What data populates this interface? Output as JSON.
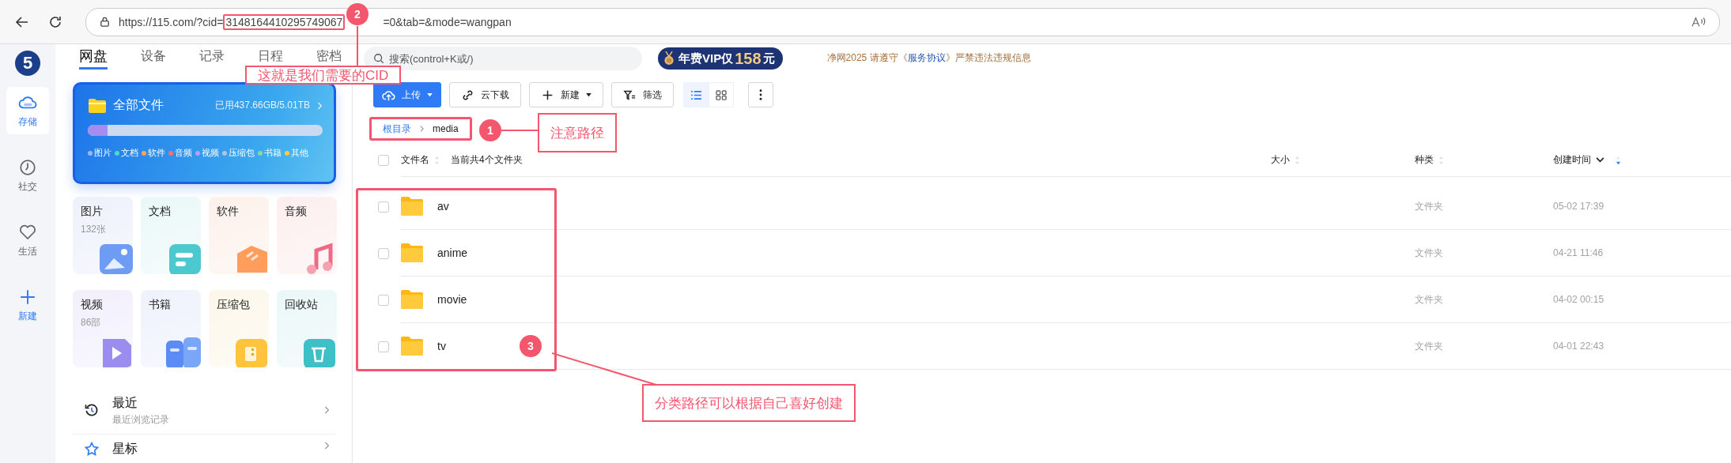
{
  "browser": {
    "url_prefix": "https://115.com/?cid=",
    "url_cid": "3148164410295749067",
    "url_tail": "=0&tab=&mode=wangpan"
  },
  "logo": "5",
  "rail": [
    {
      "label": "存储",
      "kind": "cloud",
      "selected": true
    },
    {
      "label": "社交",
      "kind": "clock",
      "selected": false
    },
    {
      "label": "生活",
      "kind": "heart",
      "selected": false
    },
    {
      "label": "新建",
      "kind": "plus",
      "selected": false
    }
  ],
  "top_tabs": [
    {
      "label": "网盘",
      "selected": true
    },
    {
      "label": "设备",
      "selected": false
    },
    {
      "label": "记录",
      "selected": false
    },
    {
      "label": "日程",
      "selected": false
    },
    {
      "label": "密档",
      "selected": false
    }
  ],
  "search": {
    "placeholder": "搜索(control+K或/)"
  },
  "vip_badge": {
    "text": "年费VIP仅",
    "price": "158",
    "unit": "元"
  },
  "notice": {
    "before": "净网2025 请遵守《",
    "link": "服务协议",
    "after": "》严禁违法违规信息"
  },
  "storage_card": {
    "title": "全部文件",
    "usage": "已用437.66GB/5.01TB",
    "level": 0.085,
    "legend": [
      {
        "label": "图片",
        "color": "#a3b5f7"
      },
      {
        "label": "文档",
        "color": "#4fd8cb"
      },
      {
        "label": "软件",
        "color": "#ffa64f"
      },
      {
        "label": "音频",
        "color": "#ff6f6f"
      },
      {
        "label": "视频",
        "color": "#b99dff"
      },
      {
        "label": "压缩包",
        "color": "#b7c2d8"
      },
      {
        "label": "书籍",
        "color": "#86d9a4"
      },
      {
        "label": "其他",
        "color": "#ffcd3a"
      }
    ]
  },
  "categories": [
    {
      "label": "图片",
      "count": "132张",
      "kind": "image"
    },
    {
      "label": "文档",
      "kind": "document"
    },
    {
      "label": "软件",
      "kind": "software"
    },
    {
      "label": "音频",
      "kind": "audio"
    },
    {
      "label": "视频",
      "count": "86部",
      "kind": "video"
    },
    {
      "label": "书籍",
      "kind": "book"
    },
    {
      "label": "压缩包",
      "kind": "archive"
    },
    {
      "label": "回收站",
      "kind": "trash"
    }
  ],
  "shortcuts": [
    {
      "title": "最近",
      "subtitle": "最近浏览记录",
      "kind": "recent"
    },
    {
      "title": "星标",
      "kind": "star"
    }
  ],
  "toolbar": [
    {
      "label": "上传",
      "kind": "upload"
    },
    {
      "label": "云下载",
      "kind": "link"
    },
    {
      "label": "新建",
      "kind": "new"
    },
    {
      "label": "筛选",
      "kind": "filter"
    }
  ],
  "view_modes": [
    {
      "kind": "list",
      "selected": true
    },
    {
      "kind": "grid",
      "selected": false
    }
  ],
  "breadcrumb": [
    "根目录",
    "media"
  ],
  "table": {
    "count_text": "当前共4个文件夹",
    "all_checked": false,
    "columns": [
      {
        "label": "文件名",
        "sorted": false
      },
      {
        "label": "大小",
        "sorted": false
      },
      {
        "label": "种类",
        "sorted": false
      },
      {
        "label": "创建时间",
        "sorted": true
      }
    ],
    "rows": [
      {
        "name": "av",
        "type": "文件夹",
        "created": "05-02 17:39",
        "checked": false
      },
      {
        "name": "anime",
        "type": "文件夹",
        "created": "04-21 11:46",
        "checked": false
      },
      {
        "name": "movie",
        "type": "文件夹",
        "created": "04-02 00:15",
        "checked": false
      },
      {
        "name": "tv",
        "type": "文件夹",
        "created": "04-01 22:43",
        "checked": false
      }
    ]
  },
  "annotations": [
    {
      "number": "1",
      "text": "注意路径"
    },
    {
      "number": "2",
      "text": "这就是我们需要的CID"
    },
    {
      "number": "3",
      "text": "分类路径可以根据自己喜好创建"
    }
  ]
}
